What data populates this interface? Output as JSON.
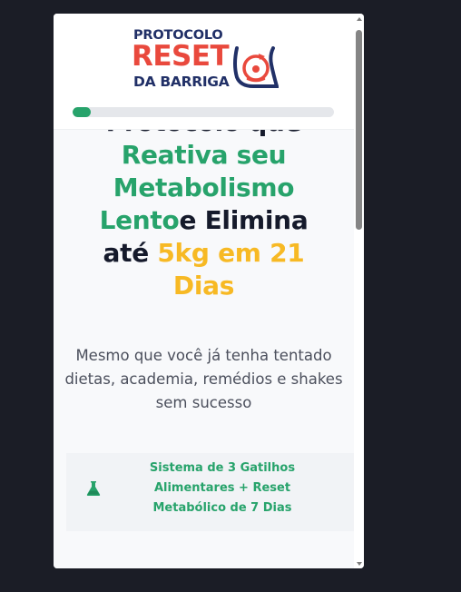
{
  "logo": {
    "top": "PROTOCOLO",
    "main": "RESET",
    "bottom": "DA BARRIGA"
  },
  "progress": {
    "value": 0.07
  },
  "hero": {
    "line0": "Protocolo que",
    "line1": "Reativa seu",
    "line2": "Metabolismo",
    "line3_green": "Lento",
    "line3_dark": "e Elimina",
    "line4_dark": "até ",
    "line4_yellow": "5kg em 21",
    "line5_yellow": "Dias"
  },
  "subtitle": "Mesmo que você já tenha tentado dietas, academia, remédios e shakes sem sucesso",
  "feature": {
    "icon": "flask-icon",
    "text": "Sistema de 3 Gatilhos Alimentares + Reset Metabólico de 7 Dias"
  },
  "colors": {
    "green": "#27a36b",
    "dark": "#151a2b",
    "yellow": "#f7b924",
    "brand_red": "#e9493d",
    "brand_navy": "#213067",
    "background": "#1b1d26"
  }
}
